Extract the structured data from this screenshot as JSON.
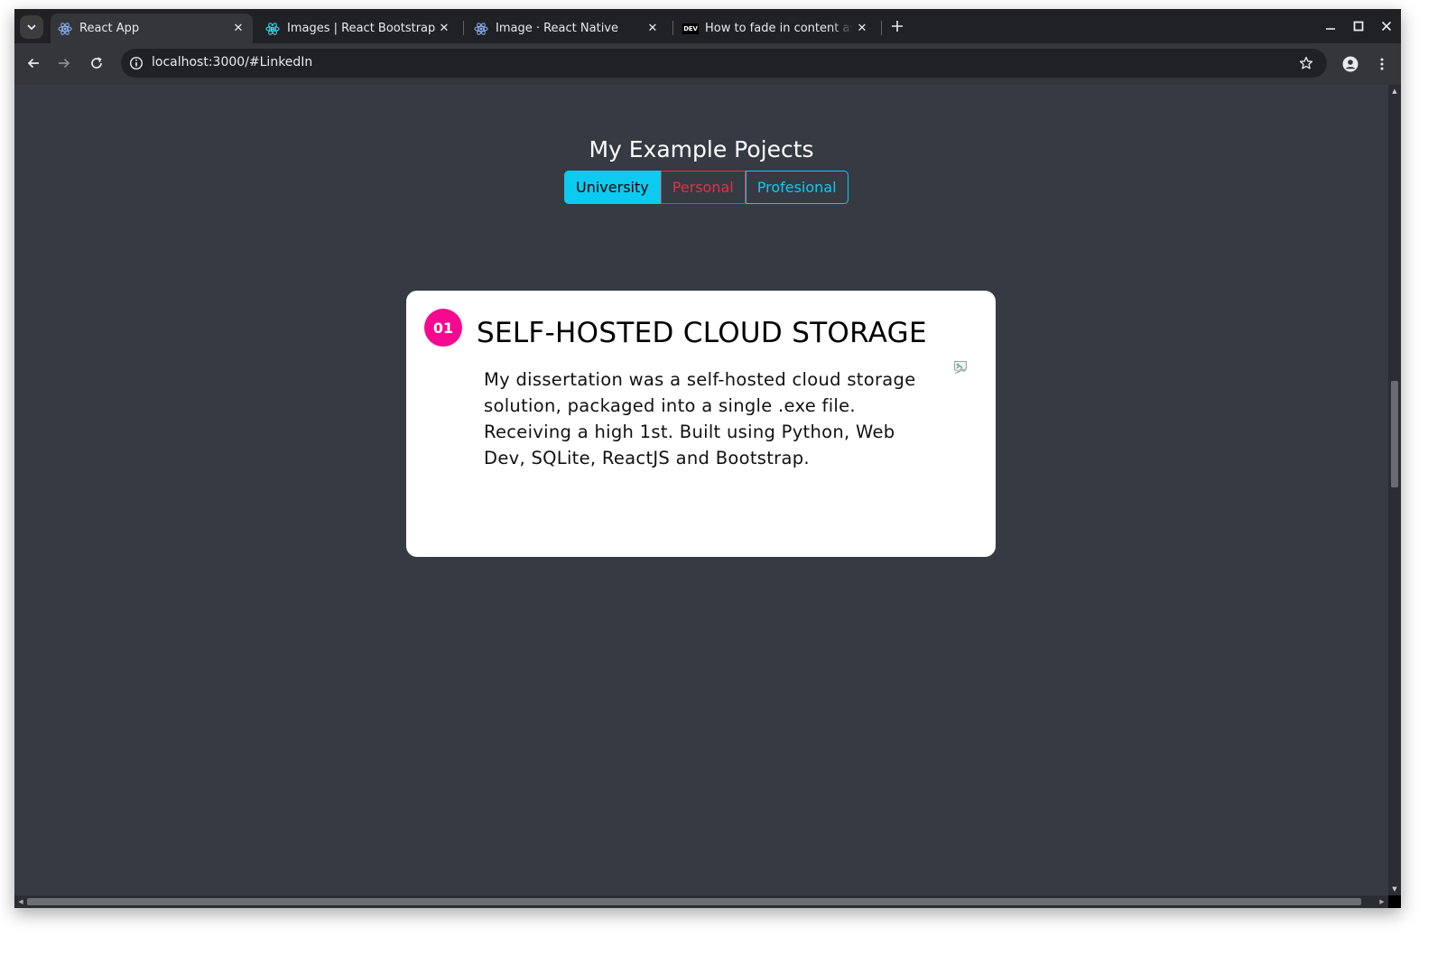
{
  "browser": {
    "tabs": [
      {
        "title": "React App",
        "favicon": "react-icon",
        "active": true
      },
      {
        "title": "Images | React Bootstrap",
        "favicon": "react-bootstrap-icon",
        "active": false
      },
      {
        "title": "Image · React Native",
        "favicon": "react-icon",
        "active": false
      },
      {
        "title": "How to fade in content as",
        "favicon": "dev-icon",
        "active": false
      }
    ],
    "dev_favicon_text": "DEV",
    "url": "localhost:3000/#LinkedIn"
  },
  "page": {
    "heading": "My Example Pojects",
    "filters": {
      "university": "University",
      "personal": "Personal",
      "profesional": "Profesional"
    },
    "project": {
      "number": "01",
      "title": "SELF-HOSTED CLOUD STORAGE",
      "description": "My dissertation was a self-hosted cloud storage solution, packaged into a single .exe file. Receiving a high 1st. Built using Python, Web Dev, SQLite, ReactJS and Bootstrap."
    }
  },
  "colors": {
    "page_bg": "#353a43",
    "info": "#0dcaf0",
    "danger": "#dc3545",
    "badge": "#f5098f"
  }
}
